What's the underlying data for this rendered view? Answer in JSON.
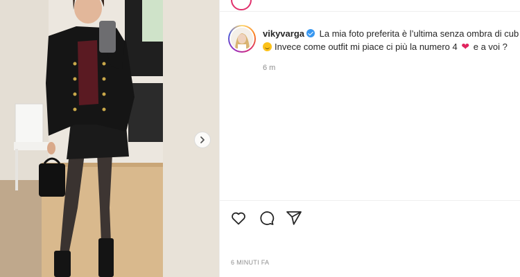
{
  "post": {
    "username": "vikyvarga",
    "verified": true,
    "caption_line1": "La mia foto preferita è l’ultima senza ombra di cub",
    "caption_line2_a": "Invece come outfit mi piace ci più la numero 4",
    "caption_line2_b": "e a voi ?",
    "comment_time": "6 m",
    "posted_time": "6 MINUTI FA"
  },
  "icons": {
    "next": "chevron-right-icon",
    "like": "heart-outline-icon",
    "comment": "speech-bubble-icon",
    "share": "paper-plane-icon",
    "verified": "verified-badge-icon",
    "smile_emoji": "grinning-face-emoji",
    "heart_emoji": "red-heart-emoji"
  },
  "colors": {
    "verified_blue": "#3897f0",
    "heart_red": "#e0245e",
    "secondary_text": "#8e8e8e",
    "border": "#efefef"
  }
}
